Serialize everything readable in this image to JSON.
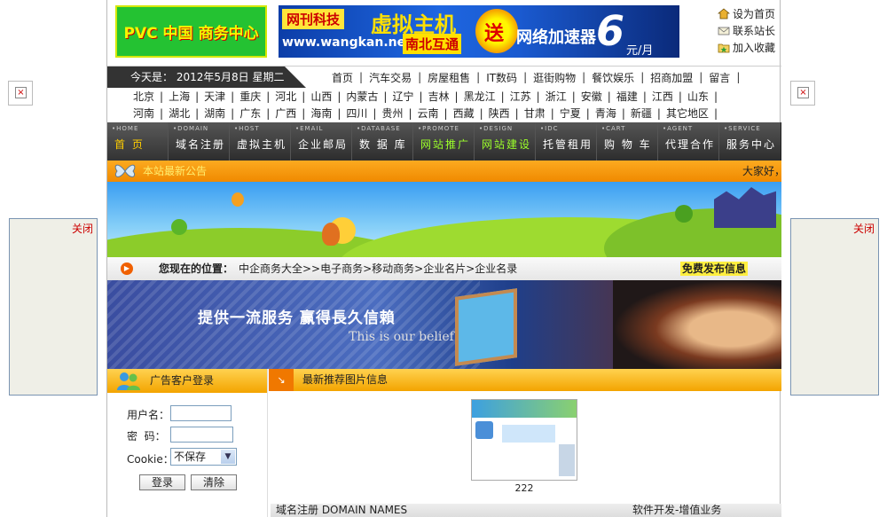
{
  "logo_text": "PVC 中国 商务中心",
  "banner": {
    "company": "网刊科技",
    "url": "www.wangkan.net",
    "product": "虚拟主机",
    "network": "南北互通",
    "gift": "送",
    "accelerator": "网络加速器",
    "price_num": "6",
    "price_unit": "元/月"
  },
  "top_links": [
    "设为首页",
    "联系站长",
    "加入收藏"
  ],
  "date_text": "今天是：  2012年5月8日  星期二",
  "main_nav": [
    "首页",
    "汽车交易",
    "房屋租售",
    "IT数码",
    "逛街购物",
    "餐饮娱乐",
    "招商加盟",
    "留言"
  ],
  "regions_row1": [
    "北京",
    "上海",
    "天津",
    "重庆",
    "河北",
    "山西",
    "内蒙古",
    "辽宁",
    "吉林",
    "黑龙江",
    "江苏",
    "浙江",
    "安徽",
    "福建",
    "江西",
    "山东"
  ],
  "regions_row2": [
    "河南",
    "湖北",
    "湖南",
    "广东",
    "广西",
    "海南",
    "四川",
    "贵州",
    "云南",
    "西藏",
    "陕西",
    "甘肃",
    "宁夏",
    "青海",
    "新疆",
    "其它地区"
  ],
  "nav_items": [
    {
      "en": "•HOME",
      "cn": "首  页"
    },
    {
      "en": "•DOMAIN",
      "cn": "域名注册"
    },
    {
      "en": "•HOST",
      "cn": "虚拟主机"
    },
    {
      "en": "•EMAIL",
      "cn": "企业邮局"
    },
    {
      "en": "•DATABASE",
      "cn": "数 据 库"
    },
    {
      "en": "•PROMOTE",
      "cn": "网站推广"
    },
    {
      "en": "•DESIGN",
      "cn": "网站建设"
    },
    {
      "en": "•IDC",
      "cn": "托管租用"
    },
    {
      "en": "•CART",
      "cn": "购 物 车"
    },
    {
      "en": "•AGENT",
      "cn": "代理合作"
    },
    {
      "en": "•SERVICE",
      "cn": "服务中心"
    }
  ],
  "notice": {
    "label": "本站最新公告",
    "marquee": "大家好，"
  },
  "location": {
    "label": "您现在的位置：",
    "path": "中企商务大全>>电子商务>移动商务>企业名片>企业名录",
    "publish": "免费发布信息"
  },
  "promo": {
    "slogan": "提供一流服务  赢得長久信賴",
    "sub": "This is our belief"
  },
  "login": {
    "title": "广告客户登录",
    "username_label": "用户名：",
    "password_label": "密  码：",
    "cookie_label": "Cookie：",
    "cookie_value": "不保存",
    "login_btn": "登录",
    "clear_btn": "清除"
  },
  "recommend": {
    "title": "最新推荐图片信息",
    "caption": "222"
  },
  "bottom": {
    "left": "域名注册 DOMAIN NAMES",
    "right": "软件开发-增值业务"
  },
  "side": {
    "close": "关闭"
  },
  "colors": {
    "accent": "#f3a400",
    "nav_bg": "#2d2d2d",
    "active": "#ffce00"
  }
}
